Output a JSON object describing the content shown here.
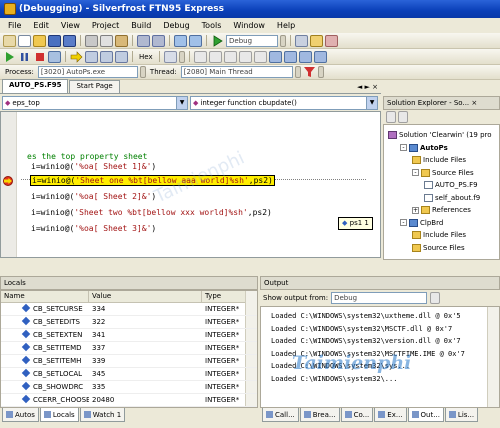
{
  "window": {
    "title": "(Debugging) - Silverfrost FTN95 Express"
  },
  "menu": [
    "File",
    "Edit",
    "View",
    "Project",
    "Build",
    "Debug",
    "Tools",
    "Window",
    "Help"
  ],
  "toolbar1": {
    "config_combo": "Debug"
  },
  "toolbar2": {
    "hex_label": "Hex"
  },
  "toolbar3": {
    "process_label": "Process:",
    "process_value": "[3020] AutoPs.exe",
    "thread_label": "Thread:",
    "thread_value": "[2080] Main Thread"
  },
  "editor": {
    "tabs": [
      "AUTO_PS.F95",
      "Start Page"
    ],
    "close_glyph": "◄ ► ×",
    "scope_left": "eps_top",
    "scope_right": "integer function cbupdate()",
    "comment_line": "es the top property sheet",
    "lines": [
      {
        "pre": "i=winio@(",
        "str": "'%oa[ Sheet 1]&'",
        "post": ")"
      },
      {
        "pre": "i=winio@(",
        "str": "'Sheet one %bt[bellow aaa world]%sh'",
        "post": ",ps2)"
      },
      {
        "pre": "i=winio@(",
        "str": "'%oa[ Sheet 2]&'",
        "post": ")"
      },
      {
        "pre": "i=winio@(",
        "str": "'Sheet two %bt[bellow xxx world]%sh'",
        "post": ",ps2)"
      },
      {
        "pre": "i=winio@(",
        "str": "'%oa[ Sheet 3]&'",
        "post": ")"
      }
    ],
    "tooltip": "ps1 1"
  },
  "solution": {
    "title": "Solution Explorer - So... ×",
    "nodes": [
      {
        "label": "Solution 'Clearwin' (19 pro",
        "icon": "sol",
        "indent": 0,
        "exp": ""
      },
      {
        "label": "AutoPs",
        "icon": "proj",
        "indent": 1,
        "exp": "-",
        "bold": true
      },
      {
        "label": "Include Files",
        "icon": "folder",
        "indent": 2,
        "exp": ""
      },
      {
        "label": "Source Files",
        "icon": "folder",
        "indent": 2,
        "exp": "-"
      },
      {
        "label": "AUTO_PS.F9",
        "icon": "file",
        "indent": 3,
        "exp": ""
      },
      {
        "label": "self_about.f9",
        "icon": "file",
        "indent": 3,
        "exp": ""
      },
      {
        "label": "References",
        "icon": "folder",
        "indent": 2,
        "exp": "+"
      },
      {
        "label": "ClpBrd",
        "icon": "proj",
        "indent": 1,
        "exp": "-"
      },
      {
        "label": "Include Files",
        "icon": "folder",
        "indent": 2,
        "exp": ""
      },
      {
        "label": "Source Files",
        "icon": "folder",
        "indent": 2,
        "exp": ""
      }
    ]
  },
  "locals": {
    "title": "Locals",
    "columns": [
      "Name",
      "Value",
      "Type"
    ],
    "rows": [
      [
        "CB_SETCURSE",
        "334",
        "INTEGER*"
      ],
      [
        "CB_SETEDITS",
        "322",
        "INTEGER*"
      ],
      [
        "CB_SETEXTEN",
        "341",
        "INTEGER*"
      ],
      [
        "CB_SETITEMD",
        "337",
        "INTEGER*"
      ],
      [
        "CB_SETITEMH",
        "339",
        "INTEGER*"
      ],
      [
        "CB_SETLOCAL",
        "345",
        "INTEGER*"
      ],
      [
        "CB_SHOWDRC",
        "335",
        "INTEGER*"
      ],
      [
        "CCERR_CHOOSE",
        "20480",
        "INTEGER*"
      ]
    ]
  },
  "output": {
    "title": "Output",
    "show_from_label": "Show output from:",
    "show_from_value": "Debug",
    "lines": [
      "Loaded C:\\WINDOWS\\system32\\uxtheme.dll @ 0x'5",
      "Loaded C:\\WINDOWS\\system32\\MSCTF.dll @ 0x'7",
      "Loaded C:\\WINDOWS\\system32\\version.dll @ 0x'7",
      "Loaded C:\\WINDOWS\\system32\\MSCTFIME.IME @ 0x'7",
      "Loaded C:\\WINDOWS\\system32\\sys...",
      "Loaded C:\\WINDOWS\\system32\\..."
    ]
  },
  "bottom_tabs_left": [
    "Autos",
    "Locals",
    "Watch 1"
  ],
  "bottom_tabs_right": [
    "Call...",
    "Brea...",
    "Co...",
    "Ex...",
    "Out...",
    "Lis..."
  ],
  "watermark": "Taimienphi"
}
